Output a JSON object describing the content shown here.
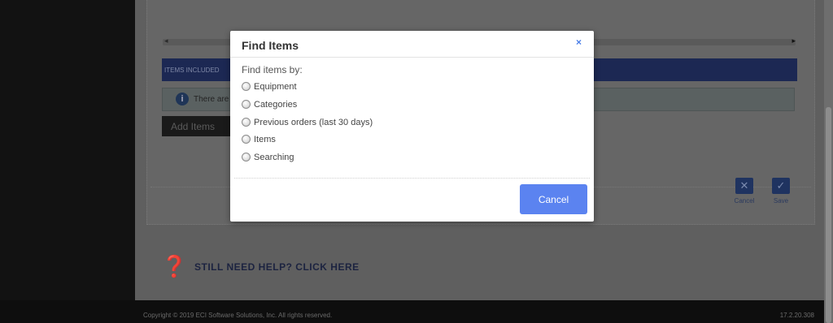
{
  "background": {
    "items_included_label": "ITEMS INCLUDED",
    "info_text": "There are",
    "add_items_label": "Add Items",
    "cancel_action_label": "Cancel",
    "save_action_label": "Save",
    "help_text": "STILL NEED HELP? CLICK HERE",
    "footer_copyright": "Copyright © 2019 ECI Software Solutions, Inc. All rights reserved.",
    "footer_version": "17.2.20.308"
  },
  "modal": {
    "title": "Find Items",
    "close_glyph": "×",
    "prompt": "Find items by:",
    "options": [
      {
        "label": "Equipment"
      },
      {
        "label": "Categories"
      },
      {
        "label": "Previous orders (last 30 days)"
      },
      {
        "label": "Items"
      },
      {
        "label": "Searching"
      }
    ],
    "cancel_label": "Cancel"
  },
  "colors": {
    "accent": "#5b83f0",
    "close": "#4a7ee8",
    "overlay": "#5f5f5f"
  }
}
